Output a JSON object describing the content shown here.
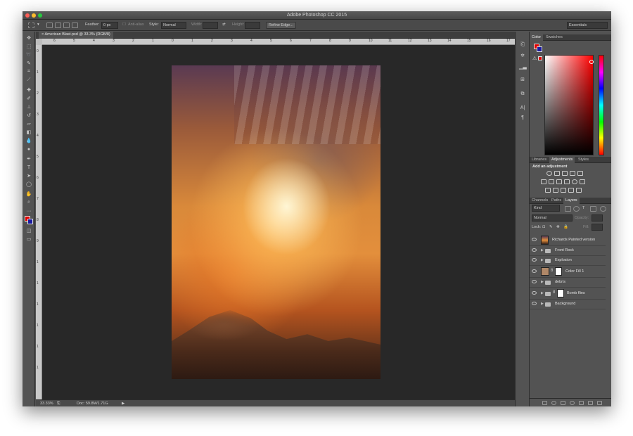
{
  "window": {
    "title": "Adobe Photoshop CC 2015"
  },
  "options_bar": {
    "feather_label": "Feather:",
    "feather_value": "0 px",
    "antialias_label": "Anti-alias",
    "style_label": "Style:",
    "style_value": "Normal",
    "width_label": "Width:",
    "height_label": "Height:",
    "refine_edge_label": "Refine Edge...",
    "workspace_value": "Essentials"
  },
  "document": {
    "tab_label": "American Blast.psd @ 33.3% (RGB/8)",
    "ruler_top_labels": [
      "6",
      "5",
      "4",
      "3",
      "2",
      "1",
      "0",
      "1",
      "2",
      "3",
      "4",
      "5",
      "6",
      "7",
      "8",
      "9",
      "10",
      "11",
      "12",
      "13",
      "14",
      "15",
      "16",
      "17"
    ],
    "ruler_left_labels": [
      "0",
      "1",
      "2",
      "3",
      "4",
      "5",
      "6",
      "7",
      "8",
      "9",
      "1",
      "1",
      "1",
      "1",
      "1",
      "1"
    ]
  },
  "status_bar": {
    "zoom": "33.33%",
    "doc_info": "Doc: 59.8M/1.71G"
  },
  "color_panel": {
    "tabs": [
      "Color",
      "Swatches"
    ],
    "foreground_color": "#e00000",
    "background_color": "#1a1aa0"
  },
  "adjustments_panel": {
    "tabs": [
      "Libraries",
      "Adjustments",
      "Styles"
    ],
    "heading": "Add an adjustment"
  },
  "layers_panel": {
    "tabs": [
      "Channels",
      "Paths",
      "Layers"
    ],
    "filter_kind": "Kind",
    "blend_mode": "Normal",
    "opacity_label": "Opacity:",
    "lock_label": "Lock:",
    "fill_label": "Fill:",
    "layers": [
      {
        "name": "Richards Painted version",
        "type": "image"
      },
      {
        "name": "Front Rock",
        "type": "group"
      },
      {
        "name": "Explosion",
        "type": "group"
      },
      {
        "name": "Color Fill 1",
        "type": "fill"
      },
      {
        "name": "debris",
        "type": "group"
      },
      {
        "name": "Bomb flies",
        "type": "group-masked"
      },
      {
        "name": "Background",
        "type": "group"
      }
    ]
  }
}
